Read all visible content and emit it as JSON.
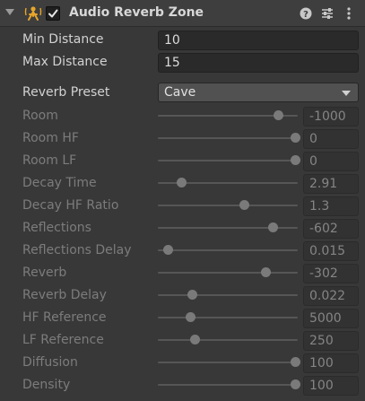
{
  "header": {
    "title": "Audio Reverb Zone",
    "enabled": true,
    "icons": [
      "foldout-arrow-icon",
      "audio-reverb-zone-icon",
      "checkbox-icon",
      "help-icon",
      "preset-icon",
      "kebab-menu-icon"
    ]
  },
  "fields": {
    "min_distance": {
      "label": "Min Distance",
      "value": "10"
    },
    "max_distance": {
      "label": "Max Distance",
      "value": "15"
    },
    "reverb_preset": {
      "label": "Reverb Preset",
      "value": "Cave"
    }
  },
  "sliders": [
    {
      "key": "room",
      "label": "Room",
      "value": "-1000",
      "level": 0.875
    },
    {
      "key": "room-hf",
      "label": "Room HF",
      "value": "0",
      "level": 1.0
    },
    {
      "key": "room-lf",
      "label": "Room LF",
      "value": "0",
      "level": 1.0
    },
    {
      "key": "decay-time",
      "label": "Decay Time",
      "value": "2.91",
      "level": 0.15
    },
    {
      "key": "decay-hf-ratio",
      "label": "Decay HF Ratio",
      "value": "1.3",
      "level": 0.62
    },
    {
      "key": "reflections",
      "label": "Reflections",
      "value": "-602",
      "level": 0.83
    },
    {
      "key": "reflections-delay",
      "label": "Reflections Delay",
      "value": "0.015",
      "level": 0.05
    },
    {
      "key": "reverb",
      "label": "Reverb",
      "value": "-302",
      "level": 0.78
    },
    {
      "key": "reverb-delay",
      "label": "Reverb Delay",
      "value": "0.022",
      "level": 0.23
    },
    {
      "key": "hf-reference",
      "label": "HF Reference",
      "value": "5000",
      "level": 0.22
    },
    {
      "key": "lf-reference",
      "label": "LF Reference",
      "value": "250",
      "level": 0.25
    },
    {
      "key": "diffusion",
      "label": "Diffusion",
      "value": "100",
      "level": 1.0
    },
    {
      "key": "density",
      "label": "Density",
      "value": "100",
      "level": 1.0
    }
  ],
  "colors": {
    "background": "#383838",
    "header": "#3e3e3e",
    "field": "#2a2a2a",
    "icon_accent": "#e8a52a",
    "dim_text": "#7c7c7c"
  }
}
